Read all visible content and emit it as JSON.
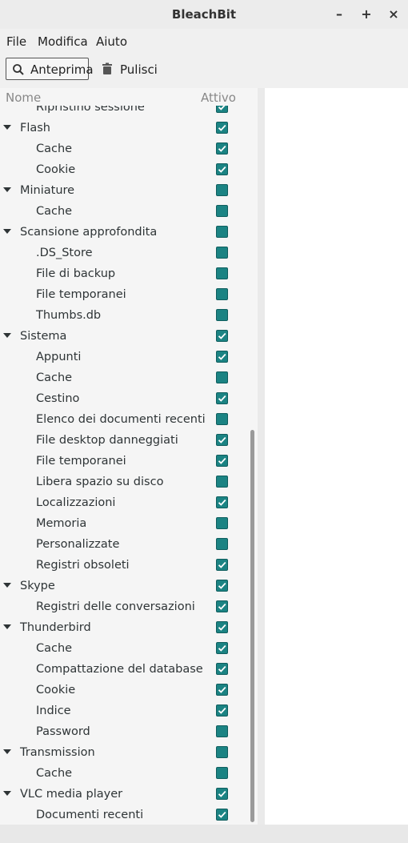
{
  "window": {
    "title": "BleachBit",
    "minimize": "–",
    "maximize": "+",
    "close": "×"
  },
  "menu": {
    "file": "File",
    "edit": "Modifica",
    "help": "Aiuto"
  },
  "toolbar": {
    "preview": "Anteprima",
    "clean": "Pulisci"
  },
  "tree": {
    "col_name": "Nome",
    "col_active": "Attivo",
    "rows": [
      {
        "label": "Ripristino sessione",
        "level": "child",
        "checked": true
      },
      {
        "label": "Flash",
        "level": "parent",
        "checked": true
      },
      {
        "label": "Cache",
        "level": "child",
        "checked": true
      },
      {
        "label": "Cookie",
        "level": "child",
        "checked": true
      },
      {
        "label": "Miniature",
        "level": "parent",
        "checked": false
      },
      {
        "label": "Cache",
        "level": "child",
        "checked": false
      },
      {
        "label": "Scansione approfondita",
        "level": "parent",
        "checked": false
      },
      {
        "label": ".DS_Store",
        "level": "child",
        "checked": false
      },
      {
        "label": "File di backup",
        "level": "child",
        "checked": false
      },
      {
        "label": "File temporanei",
        "level": "child",
        "checked": false
      },
      {
        "label": "Thumbs.db",
        "level": "child",
        "checked": false
      },
      {
        "label": "Sistema",
        "level": "parent",
        "checked": true
      },
      {
        "label": "Appunti",
        "level": "child",
        "checked": true
      },
      {
        "label": "Cache",
        "level": "child",
        "checked": false
      },
      {
        "label": "Cestino",
        "level": "child",
        "checked": true
      },
      {
        "label": "Elenco dei documenti recenti",
        "level": "child",
        "checked": false
      },
      {
        "label": "File desktop danneggiati",
        "level": "child",
        "checked": true
      },
      {
        "label": "File temporanei",
        "level": "child",
        "checked": true
      },
      {
        "label": "Libera spazio su disco",
        "level": "child",
        "checked": false
      },
      {
        "label": "Localizzazioni",
        "level": "child",
        "checked": true
      },
      {
        "label": "Memoria",
        "level": "child",
        "checked": false
      },
      {
        "label": "Personalizzate",
        "level": "child",
        "checked": false
      },
      {
        "label": "Registri obsoleti",
        "level": "child",
        "checked": true
      },
      {
        "label": "Skype",
        "level": "parent",
        "checked": true
      },
      {
        "label": "Registri delle conversazioni",
        "level": "child",
        "checked": true
      },
      {
        "label": "Thunderbird",
        "level": "parent",
        "checked": true
      },
      {
        "label": "Cache",
        "level": "child",
        "checked": true
      },
      {
        "label": "Compattazione del database",
        "level": "child",
        "checked": true
      },
      {
        "label": "Cookie",
        "level": "child",
        "checked": true
      },
      {
        "label": "Indice",
        "level": "child",
        "checked": true
      },
      {
        "label": "Password",
        "level": "child",
        "checked": false
      },
      {
        "label": "Transmission",
        "level": "parent",
        "checked": false
      },
      {
        "label": "Cache",
        "level": "child",
        "checked": false
      },
      {
        "label": "VLC media player",
        "level": "parent",
        "checked": true
      },
      {
        "label": "Documenti recenti",
        "level": "child",
        "checked": true
      }
    ]
  },
  "colors": {
    "checkbox": "#1b8383"
  }
}
